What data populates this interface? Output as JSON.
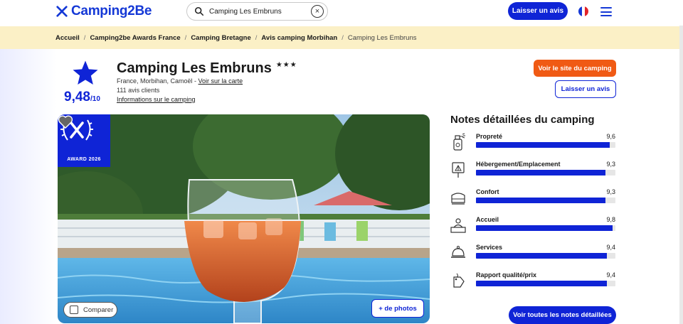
{
  "brand": {
    "name": "Camping2Be",
    "color": "#1438d6"
  },
  "search": {
    "value": "Camping Les Embruns",
    "placeholder": ""
  },
  "header": {
    "review_button": "Laisser un avis",
    "language_icon": "france-flag-icon",
    "menu_icon": "hamburger-menu-icon"
  },
  "breadcrumb": [
    {
      "label": "Accueil"
    },
    {
      "label": "Camping2be Awards France"
    },
    {
      "label": "Camping Bretagne"
    },
    {
      "label": "Avis camping Morbihan"
    },
    {
      "label": "Camping Les Embruns"
    }
  ],
  "campsite": {
    "name": "Camping Les Embruns",
    "stars": "★★★",
    "score": "9,48",
    "score_scale": "/10",
    "location": "France, Morbihan, Camoël",
    "location_sep": " - ",
    "map_link": "Voir sur la carte",
    "reviews_count": "111 avis clients",
    "info_link": "Informations sur le camping"
  },
  "actions": {
    "site_button": "Voir le site du camping",
    "review_button": "Laisser un avis"
  },
  "photo": {
    "award_label": "AWARD 2026",
    "compare_label": "Comparer",
    "more_photos": "+ de photos"
  },
  "ratings": {
    "title": "Notes détaillées du camping",
    "items": [
      {
        "label": "Propreté",
        "value": "9,6",
        "score": 9.6,
        "icon": "spray-bottle-icon"
      },
      {
        "label": "Hébergement/Emplacement",
        "value": "9,3",
        "score": 9.3,
        "icon": "tent-sign-icon"
      },
      {
        "label": "Confort",
        "value": "9,3",
        "score": 9.3,
        "icon": "bed-icon"
      },
      {
        "label": "Accueil",
        "value": "9,8",
        "score": 9.8,
        "icon": "reception-desk-icon"
      },
      {
        "label": "Services",
        "value": "9,4",
        "score": 9.4,
        "icon": "service-bell-icon"
      },
      {
        "label": "Rapport qualité/prix",
        "value": "9,4",
        "score": 9.4,
        "icon": "price-tag-icon"
      }
    ],
    "all_button": "Voir toutes les notes détaillées"
  },
  "colors": {
    "primary": "#0f24d6",
    "orange": "#f05a14",
    "breadcrumb_bg": "#fbf0c6"
  }
}
